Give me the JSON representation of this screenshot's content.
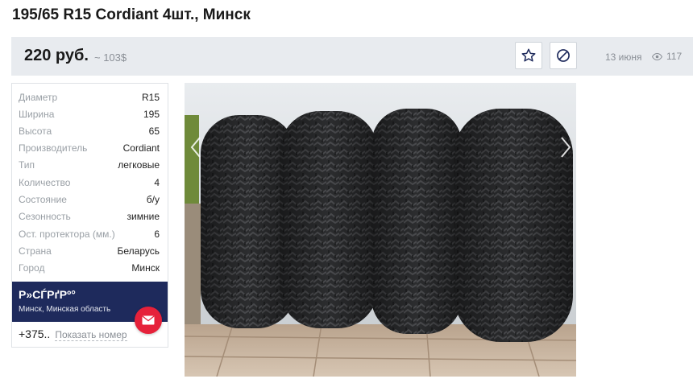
{
  "listing": {
    "title": "195/65 R15 Cordiant 4шт., Минск",
    "price": "220 руб.",
    "price_alt": "~ 103$",
    "date": "13 июня",
    "views": "117"
  },
  "specs": [
    {
      "key": "Диаметр",
      "value": "R15"
    },
    {
      "key": "Ширина",
      "value": "195"
    },
    {
      "key": "Высота",
      "value": "65"
    },
    {
      "key": "Производитель",
      "value": "Cordiant"
    },
    {
      "key": "Тип",
      "value": "легковые"
    },
    {
      "key": "Количество",
      "value": "4"
    },
    {
      "key": "Состояние",
      "value": "б/у"
    },
    {
      "key": "Сезонность",
      "value": "зимние"
    },
    {
      "key": "Ост. протектора (мм.)",
      "value": "6"
    },
    {
      "key": "Страна",
      "value": "Беларусь"
    },
    {
      "key": "Город",
      "value": "Минск"
    }
  ],
  "seller": {
    "name": "Р»СЃРґРº°",
    "location": "Минск, Минская область",
    "phone": "+375..",
    "show_phone_label": "Показать номер"
  },
  "icons": {
    "favorite": "star-outline-icon",
    "block": "block-icon",
    "views": "eye-icon",
    "mail": "envelope-icon",
    "prev": "chevron-left-icon",
    "next": "chevron-right-icon"
  },
  "colors": {
    "seller_bg": "#1e2a5c",
    "mail_button": "#e6213a",
    "price_bar_bg": "#e8ebef"
  }
}
